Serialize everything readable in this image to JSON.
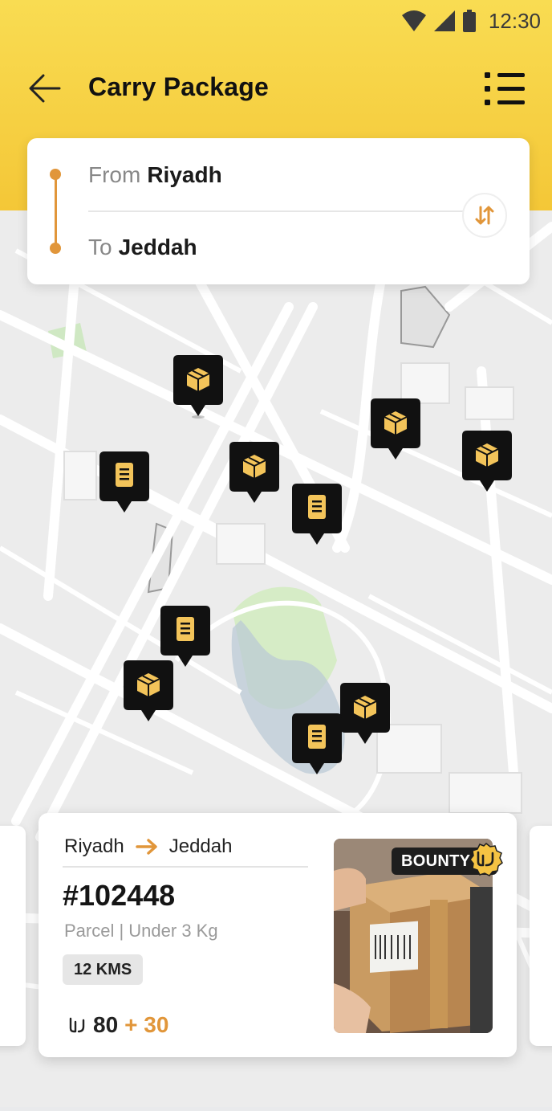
{
  "status_bar": {
    "time": "12:30"
  },
  "header": {
    "title": "Carry Package"
  },
  "route": {
    "from_label": "From",
    "from_value": "Riyadh",
    "to_label": "To",
    "to_value": "Jeddah"
  },
  "map": {
    "pins": [
      {
        "type": "package-icon"
      },
      {
        "type": "document-icon"
      },
      {
        "type": "package-icon"
      },
      {
        "type": "document-icon"
      },
      {
        "type": "package-icon"
      },
      {
        "type": "package-icon"
      },
      {
        "type": "document-icon"
      },
      {
        "type": "package-icon"
      },
      {
        "type": "package-icon"
      },
      {
        "type": "document-icon"
      }
    ]
  },
  "job_card": {
    "from": "Riyadh",
    "to": "Jeddah",
    "id": "#102448",
    "description": "Parcel | Under 3 Kg",
    "distance": "12 KMS",
    "price": "80",
    "bonus": "+ 30",
    "bounty_label": "BOUNTY"
  },
  "colors": {
    "accent": "#e1963a",
    "header_yellow": "#f6d040",
    "pin_black": "#111111",
    "pin_gold": "#f0b43c"
  }
}
